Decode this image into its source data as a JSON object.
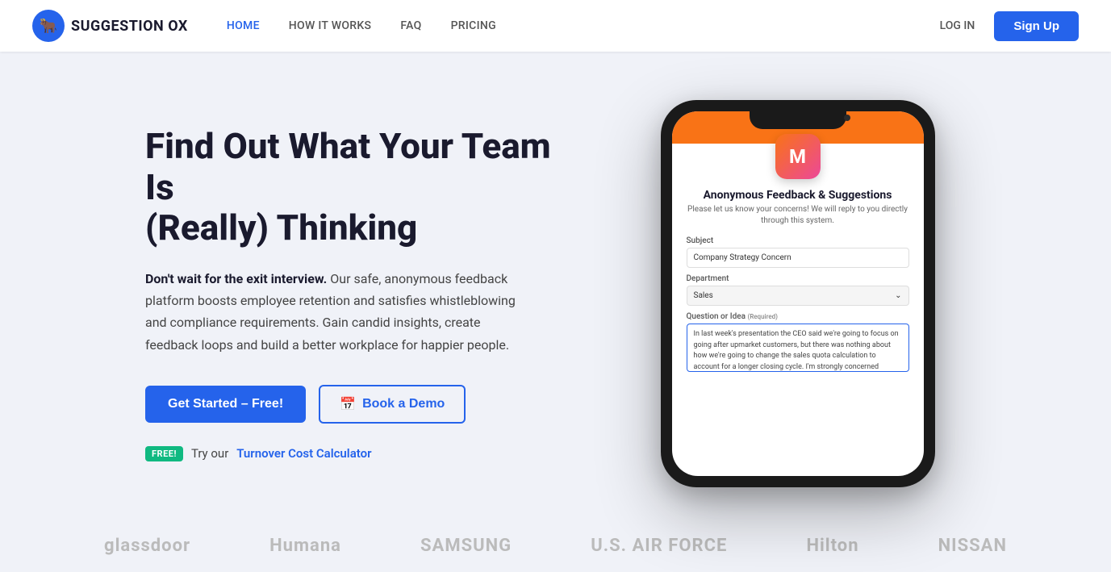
{
  "nav": {
    "logo_text": "SUGGESTION OX",
    "links": [
      {
        "label": "HOME",
        "active": true
      },
      {
        "label": "HOW IT WORKS",
        "active": false
      },
      {
        "label": "FAQ",
        "active": false
      },
      {
        "label": "PRICING",
        "active": false
      },
      {
        "label": "LOG IN",
        "active": false
      }
    ],
    "signup_label": "Sign Up"
  },
  "hero": {
    "title_line1": "Find Out What Your Team Is",
    "title_line2": "(Really) Thinking",
    "desc_bold": "Don't wait for the exit interview.",
    "desc_rest": " Our safe, anonymous feedback platform boosts employee retention and satisfies whistleblowing and compliance requirements. Gain candid insights, create feedback loops and build a better workplace for happier people.",
    "btn_primary": "Get Started – Free!",
    "btn_secondary_icon": "📅",
    "btn_secondary": "Book a Demo",
    "free_badge": "FREE!",
    "free_text": "Try our",
    "free_link": "Turnover Cost Calculator"
  },
  "phone": {
    "app_letter": "M",
    "form_title": "Anonymous Feedback & Suggestions",
    "form_subtitle": "Please let us know your concerns! We will reply to you directly through this system.",
    "subject_label": "Subject",
    "subject_value": "Company Strategy Concern",
    "department_label": "Department",
    "department_value": "Sales",
    "question_label": "Question or Idea",
    "question_required": "(Required)",
    "question_value": "In last week's presentation the CEO said we're going to focus on going after upmarket customers, but there was nothing about how we're going to change the sales quota calculation to account for a longer closing cycle. I'm strongly concerned"
  },
  "brands": {
    "items": [
      "glassdoor",
      "Humana",
      "SAMSUNG",
      "U.S. AIR FORCE",
      "Hilton",
      "NISSAN"
    ]
  }
}
